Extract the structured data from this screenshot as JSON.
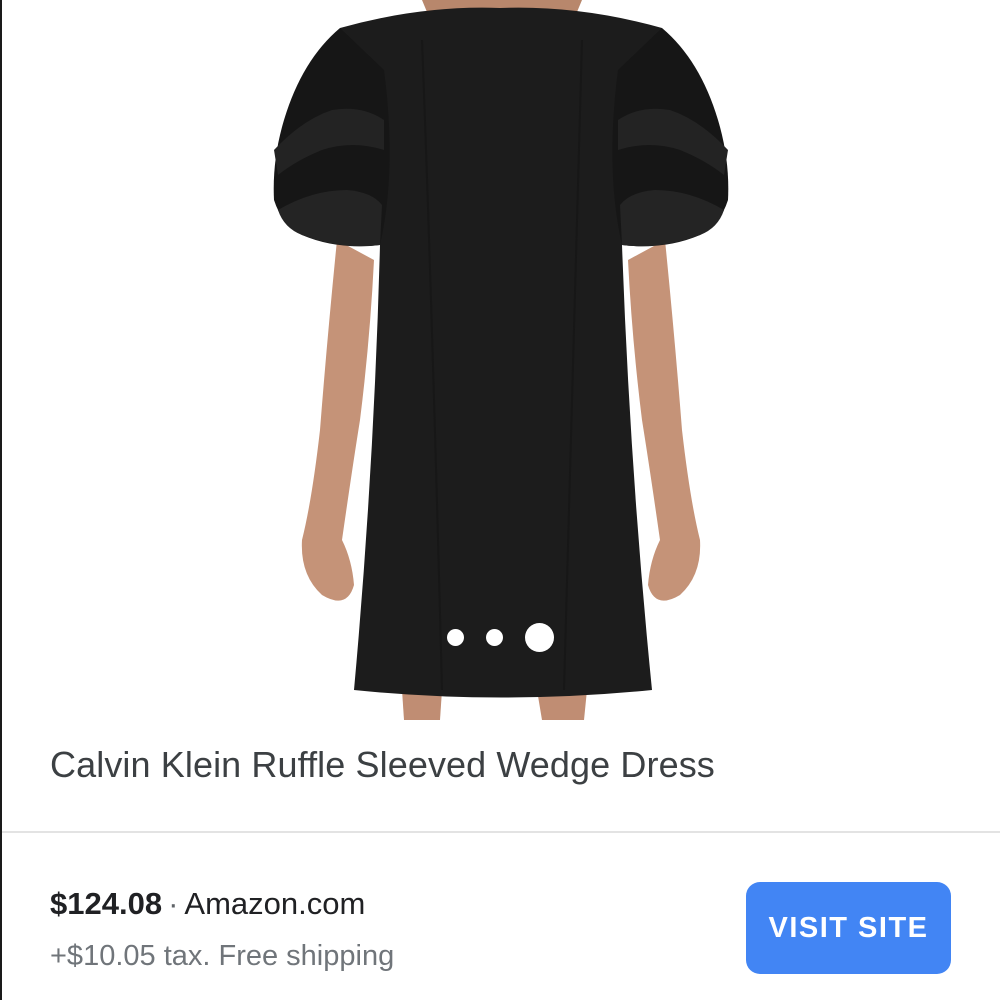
{
  "product": {
    "title": "Calvin Klein Ruffle Sleeved Wedge Dress",
    "image_alt_icon": "dress-photo",
    "carousel": {
      "dot_count": 3,
      "active_index": 2
    }
  },
  "offer": {
    "price": "$124.08",
    "separator": "·",
    "seller": "Amazon.com",
    "tax_shipping": "+$10.05 tax. Free shipping"
  },
  "actions": {
    "visit_label": "VISIT SITE"
  },
  "colors": {
    "accent": "#4285f4",
    "title_text": "#3c4043",
    "secondary_text": "#70757a",
    "divider": "#e3e3e3",
    "dress": "#1c1c1c",
    "skin": "#c59378"
  }
}
